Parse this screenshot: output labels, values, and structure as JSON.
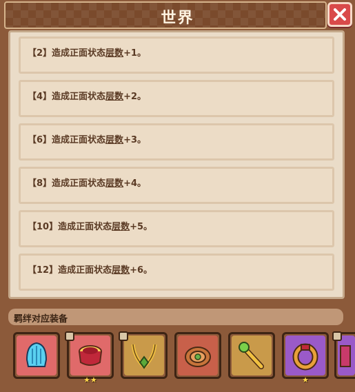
{
  "window": {
    "title": "世界",
    "close_icon": "close-icon"
  },
  "effects": [
    {
      "prefix": "【2】造成正面状态",
      "keyword": "层数",
      "suffix": "+1。"
    },
    {
      "prefix": "【4】造成正面状态",
      "keyword": "层数",
      "suffix": "+2。"
    },
    {
      "prefix": "【6】造成正面状态",
      "keyword": "层数",
      "suffix": "+3。"
    },
    {
      "prefix": "【8】造成正面状态",
      "keyword": "层数",
      "suffix": "+4。"
    },
    {
      "prefix": "【10】造成正面状态",
      "keyword": "层数",
      "suffix": "+5。"
    },
    {
      "prefix": "【12】造成正面状态",
      "keyword": "层数",
      "suffix": "+6。"
    }
  ],
  "equipment": {
    "label": "羁绊对应装备",
    "items": [
      {
        "icon": "blue-helmet-icon",
        "bg": "#e06a6a",
        "stars": "",
        "badge": false
      },
      {
        "icon": "red-drum-icon",
        "bg": "#e06a6a",
        "stars": "★★",
        "badge": true
      },
      {
        "icon": "gold-necklace-icon",
        "bg": "#c99a4a",
        "stars": "",
        "badge": true
      },
      {
        "icon": "round-shield-icon",
        "bg": "#c8604a",
        "stars": "",
        "badge": false
      },
      {
        "icon": "gold-scepter-icon",
        "bg": "#c99a4a",
        "stars": "",
        "badge": false
      },
      {
        "icon": "gold-ring-icon",
        "bg": "#9a5ac8",
        "stars": "★",
        "badge": false
      },
      {
        "icon": "partial-item-icon",
        "bg": "#9a5ac8",
        "stars": "",
        "badge": true
      }
    ]
  }
}
